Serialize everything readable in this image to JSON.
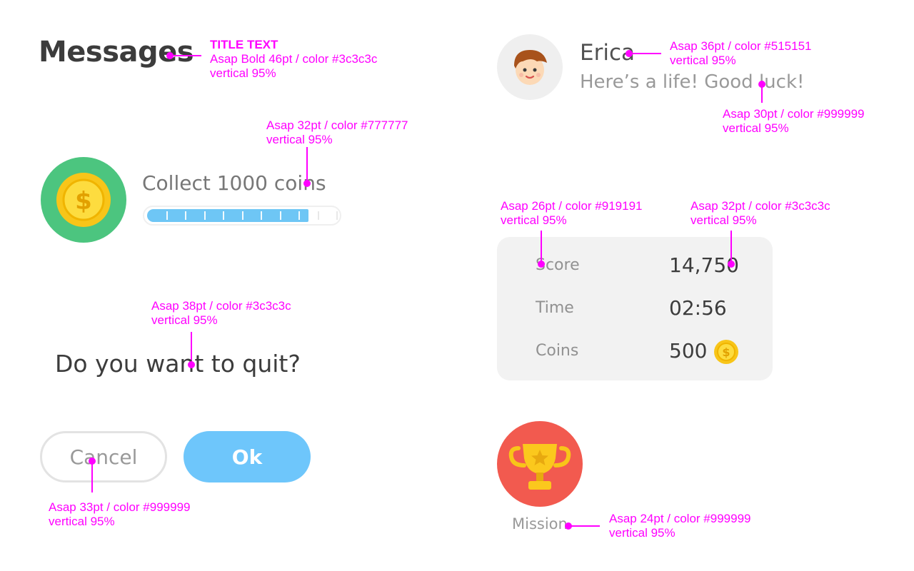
{
  "title": {
    "text": "Messages",
    "annotation_head": "TITLE TEXT",
    "annotation_spec": "Asap Bold 46pt / color #3c3c3c",
    "annotation_vertical": "vertical 95%"
  },
  "quest": {
    "label": "Collect 1000 coins",
    "progress_fraction": 0.85,
    "progress_color": "#6ec6f5",
    "badge_color": "#4cc57f",
    "icon": "coin-icon",
    "annotation_spec": "Asap 32pt / color #777777",
    "annotation_vertical": "vertical 95%"
  },
  "quit_dialog": {
    "question": "Do you want to quit?",
    "cancel_label": "Cancel",
    "ok_label": "Ok",
    "ok_color": "#6ec6fb",
    "question_annotation_spec": "Asap 38pt / color #3c3c3c",
    "question_annotation_vertical": "vertical 95%",
    "cancel_annotation_spec": "Asap 33pt / color #999999",
    "cancel_annotation_vertical": "vertical 95%"
  },
  "message": {
    "sender": "Erica",
    "text": "Here’s a life! Good luck!",
    "avatar_icon": "boy-avatar-icon",
    "sender_annotation_spec": "Asap 36pt / color #515151",
    "sender_annotation_vertical": "vertical 95%",
    "text_annotation_spec": "Asap 30pt / color #999999",
    "text_annotation_vertical": "vertical 95%"
  },
  "score_card": {
    "rows": [
      {
        "label": "Score",
        "value": "14,750"
      },
      {
        "label": "Time",
        "value": "02:56"
      },
      {
        "label": "Coins",
        "value": "500"
      }
    ],
    "coin_icon": "coin-icon",
    "label_annotation_spec": "Asap 26pt / color #919191",
    "label_annotation_vertical": "vertical 95%",
    "value_annotation_spec": "Asap 32pt / color #3c3c3c",
    "value_annotation_vertical": "vertical 95%"
  },
  "mission": {
    "label": "Mission",
    "icon": "trophy-icon",
    "badge_color": "#f25a4f",
    "annotation_spec": "Asap 24pt / color #999999",
    "annotation_vertical": "vertical 95%"
  }
}
